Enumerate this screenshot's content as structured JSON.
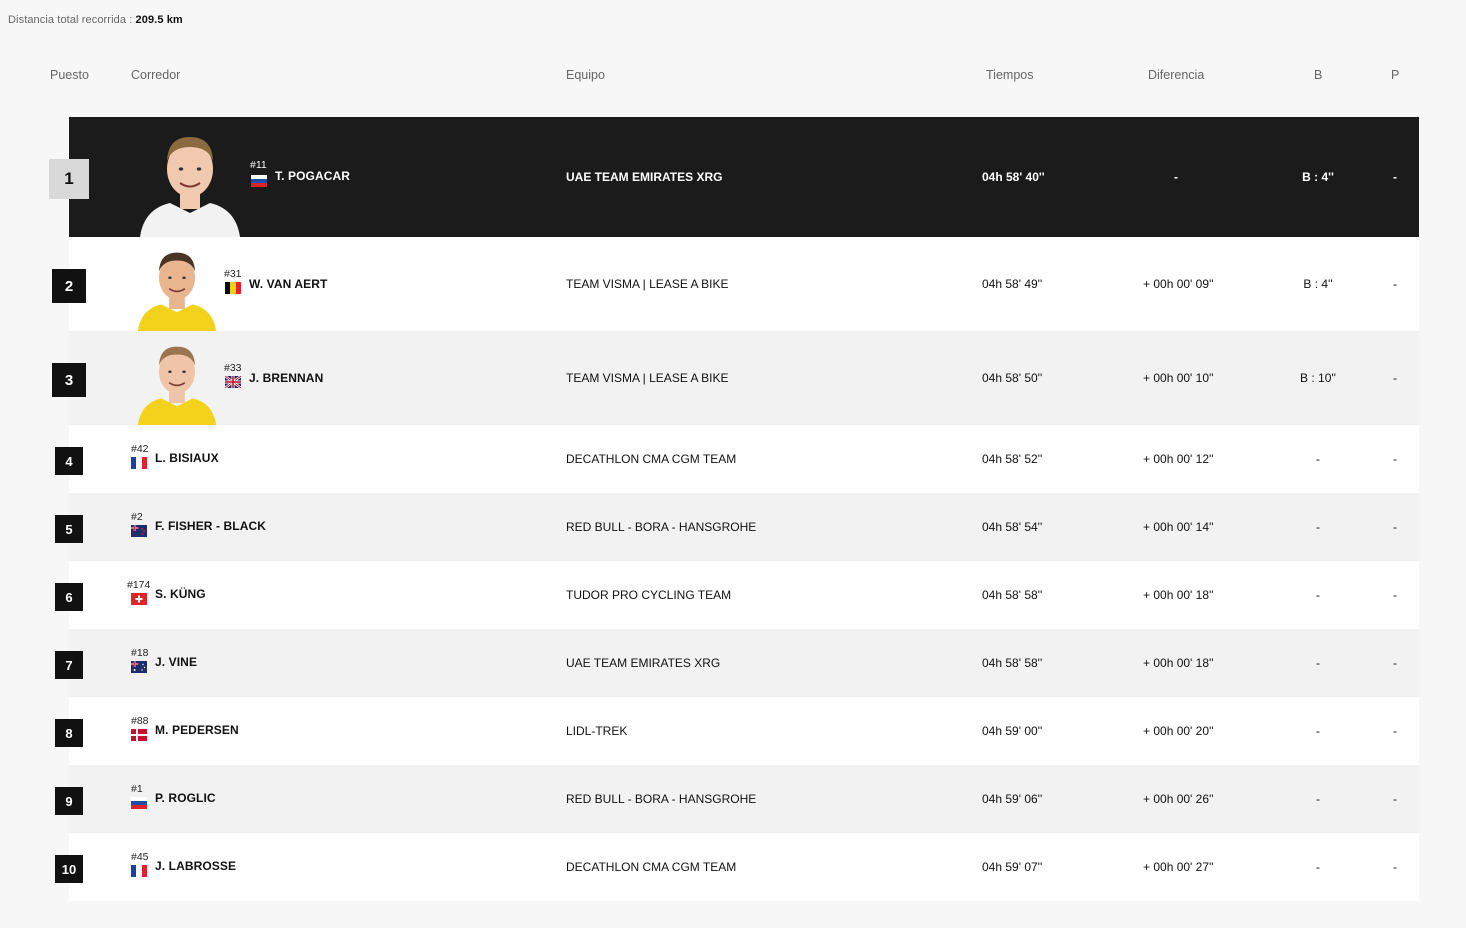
{
  "distance": {
    "label": "Distancia total recorrida :",
    "value": "209.5 km"
  },
  "headers": {
    "puesto": "Puesto",
    "corredor": "Corredor",
    "equipo": "Equipo",
    "tiempos": "Tiempos",
    "diferencia": "Diferencia",
    "b": "B",
    "p": "P"
  },
  "riders": [
    {
      "rank": "1",
      "bib": "#11",
      "name": "T. POGACAR",
      "flag": "slovenia",
      "team": "UAE TEAM EMIRATES XRG",
      "time": "04h 58' 40''",
      "diff": "-",
      "b": "B : 4''",
      "p": "-"
    },
    {
      "rank": "2",
      "bib": "#31",
      "name": "W. VAN AERT",
      "flag": "belgium",
      "team": "TEAM VISMA | LEASE A BIKE",
      "time": "04h 58' 49''",
      "diff": "+ 00h 00' 09''",
      "b": "B : 4''",
      "p": "-"
    },
    {
      "rank": "3",
      "bib": "#33",
      "name": "J. BRENNAN",
      "flag": "great-britain",
      "team": "TEAM VISMA | LEASE A BIKE",
      "time": "04h 58' 50''",
      "diff": "+ 00h 00' 10''",
      "b": "B : 10''",
      "p": "-"
    },
    {
      "rank": "4",
      "bib": "#42",
      "name": "L. BISIAUX",
      "flag": "france",
      "team": "DECATHLON CMA CGM TEAM",
      "time": "04h 58' 52''",
      "diff": "+ 00h 00' 12''",
      "b": "-",
      "p": "-"
    },
    {
      "rank": "5",
      "bib": "#2",
      "name": "F. FISHER - BLACK",
      "flag": "new-zealand",
      "team": "RED BULL - BORA - HANSGROHE",
      "time": "04h 58' 54''",
      "diff": "+ 00h 00' 14''",
      "b": "-",
      "p": "-"
    },
    {
      "rank": "6",
      "bib": "#174",
      "name": "S. KÜNG",
      "flag": "switzerland",
      "team": "TUDOR PRO CYCLING TEAM",
      "time": "04h 58' 58''",
      "diff": "+ 00h 00' 18''",
      "b": "-",
      "p": "-"
    },
    {
      "rank": "7",
      "bib": "#18",
      "name": "J. VINE",
      "flag": "australia",
      "team": "UAE TEAM EMIRATES XRG",
      "time": "04h 58' 58''",
      "diff": "+ 00h 00' 18''",
      "b": "-",
      "p": "-"
    },
    {
      "rank": "8",
      "bib": "#88",
      "name": "M. PEDERSEN",
      "flag": "denmark",
      "team": "LIDL-TREK",
      "time": "04h 59' 00''",
      "diff": "+ 00h 00' 20''",
      "b": "-",
      "p": "-"
    },
    {
      "rank": "9",
      "bib": "#1",
      "name": "P. ROGLIC",
      "flag": "slovenia",
      "team": "RED BULL - BORA - HANSGROHE",
      "time": "04h 59' 06''",
      "diff": "+ 00h 00' 26''",
      "b": "-",
      "p": "-"
    },
    {
      "rank": "10",
      "bib": "#45",
      "name": "J. LABROSSE",
      "flag": "france",
      "team": "DECATHLON CMA CGM TEAM",
      "time": "04h 59' 07''",
      "diff": "+ 00h 00' 27''",
      "b": "-",
      "p": "-"
    }
  ],
  "colors": {
    "leader_bg": "#1b1b1b",
    "rank_badge": "#111111",
    "leader_badge": "#d9d9d9",
    "row_alt": "#f2f2f2"
  }
}
